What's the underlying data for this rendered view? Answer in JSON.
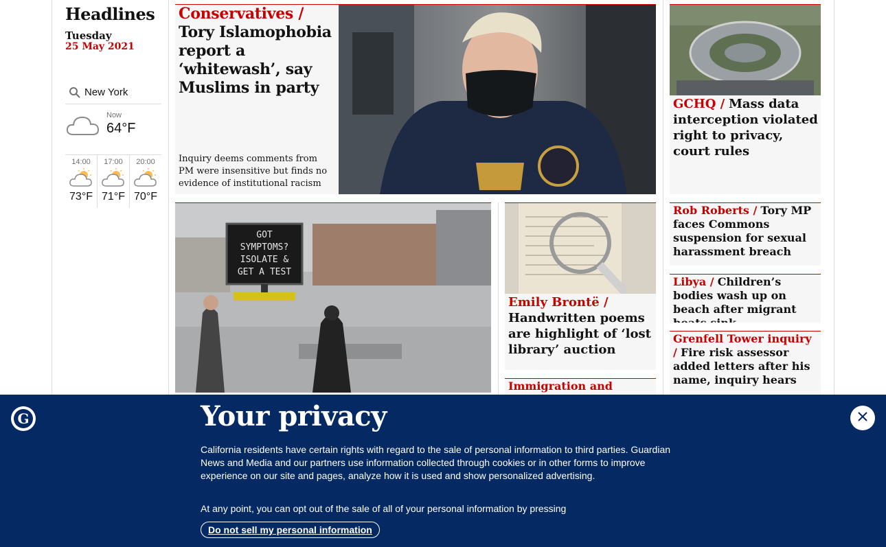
{
  "sidebar": {
    "title": "Headlines",
    "date_day": "Tuesday",
    "date_full": "25 May 2021",
    "weather": {
      "location": "New York",
      "now_label": "Now",
      "now_temp": "64°F",
      "now_icon": "cloud-icon",
      "forecast": [
        {
          "time": "14:00",
          "temp": "73°F",
          "icon": "sun-cloud-icon"
        },
        {
          "time": "17:00",
          "temp": "71°F",
          "icon": "sun-cloud-icon"
        },
        {
          "time": "20:00",
          "temp": "70°F",
          "icon": "sun-cloud-icon"
        }
      ]
    }
  },
  "stories": {
    "main": {
      "kicker": "Conservatives /",
      "headline": "Tory Islamophobia report a ‘whitewash’, say Muslims in party",
      "standfirst": "Inquiry deems comments from PM were insensitive but finds no evidence of institutional racism"
    },
    "gchq": {
      "kicker": "GCHQ /",
      "headline": "Mass data interception violated right to privacy, court rules"
    },
    "bronte": {
      "kicker": "Emily Brontë /",
      "headline": "Handwritten poems are highlight of ‘lost library’ auction"
    },
    "immigration": {
      "kicker": "Immigration and asylum"
    },
    "roberts": {
      "kicker": "Rob Roberts /",
      "headline": "Tory MP faces Commons suspension for sexual harassment breach"
    },
    "libya": {
      "kicker": "Libya /",
      "headline": "Children’s bodies wash up on beach after migrant boats sink"
    },
    "grenfell": {
      "kicker": "Grenfell Tower inquiry /",
      "headline": "Fire risk assessor added letters after his name, inquiry hears"
    },
    "covid_sign": {
      "line1": "GOT",
      "line2": "SYMPTOMS?",
      "line3": "ISOLATE &",
      "line4": "GET A TEST"
    }
  },
  "privacy": {
    "title": "Your privacy",
    "body": "California residents have certain rights with regard to the sale of personal information to third parties. Guardian News and Media and our partners use information collected through cookies or in other forms to improve experience on our site and pages, analyze how it is used and show personalized advertising.",
    "body2": "At any point, you can opt out of the sale of all of your personal information by pressing",
    "button": "Do not sell my personal information"
  },
  "colors": {
    "accent": "#c70000",
    "banner": "#052962",
    "card_bg": "#f6f6f6"
  }
}
